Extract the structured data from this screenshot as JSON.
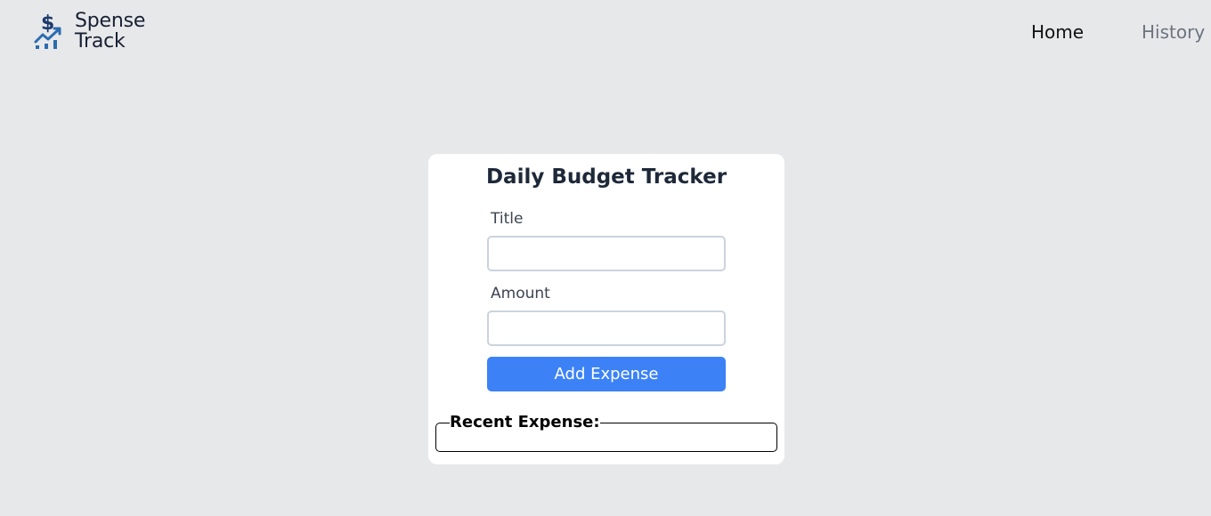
{
  "app": {
    "logo_line1": "Spense",
    "logo_line2": "Track"
  },
  "nav": {
    "home": "Home",
    "history": "History"
  },
  "form": {
    "title": "Daily Budget Tracker",
    "title_label": "Title",
    "title_value": "",
    "amount_label": "Amount",
    "amount_value": "",
    "submit_label": "Add Expense"
  },
  "recent": {
    "legend": "Recent Expense:"
  },
  "colors": {
    "background": "#e7e8ea",
    "accent": "#3c82f6",
    "logo_blue": "#2b6cb0"
  },
  "icons": {
    "logo": "dollar-chart-icon"
  }
}
